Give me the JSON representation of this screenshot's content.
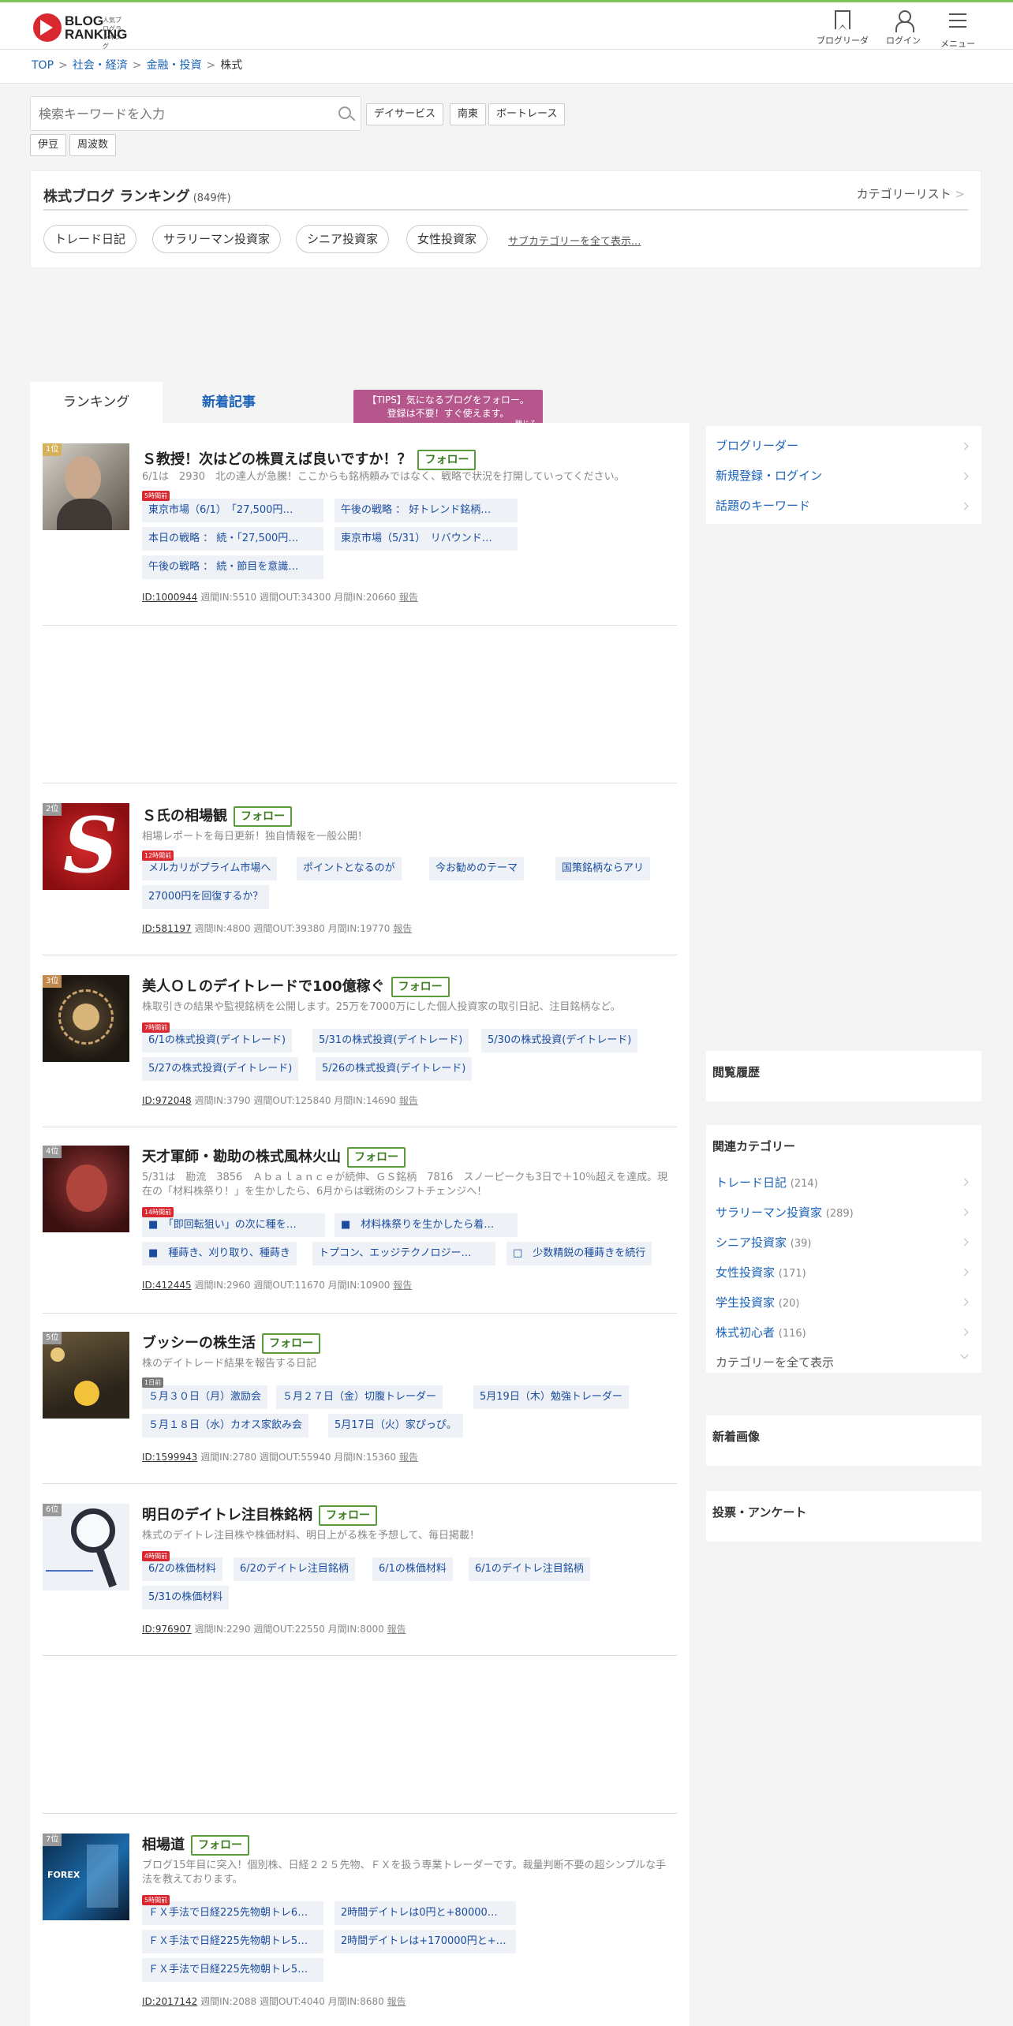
{
  "header": {
    "logo_line1": "BLOG",
    "logo_line2": "RANKING",
    "logo_sub": "人気ブログランキング",
    "nav": [
      {
        "label": "ブログリーダー",
        "icon": "bookmark-icon"
      },
      {
        "label": "ログイン",
        "icon": "user-icon"
      },
      {
        "label": "メニュー",
        "icon": "hamburger-menu-icon"
      }
    ],
    "accent_color": "#7cc35a"
  },
  "breadcrumb": {
    "items": [
      "TOP",
      "社会・経済",
      "金融・投資"
    ],
    "current": "株式",
    "separator": ">"
  },
  "search": {
    "placeholder": "検索キーワードを入力",
    "keywords": [
      "デイサービス",
      "南東",
      "ボートレース",
      "伊豆",
      "周波数"
    ]
  },
  "category": {
    "title": "株式ブログ ランキング",
    "count": "(849件)",
    "list_link": "カテゴリーリスト",
    "subcategories": [
      "トレード日記",
      "サラリーマン投資家",
      "シニア投資家",
      "女性投資家"
    ],
    "show_all_sub": "サブカテゴリーを全て表示..."
  },
  "tabs": {
    "ranking": "ランキング",
    "new_articles": "新着記事"
  },
  "tips": {
    "line1": "【TIPS】気になるブログをフォロー。",
    "line2": "登録は不要！すぐ使えます。",
    "close": "閉じる"
  },
  "follow_label": "フォロー",
  "entries": [
    {
      "rank": "1位",
      "title": "Ｓ教授！次はどの株買えば良いですか！？",
      "desc": "6/1は　2930　北の達人が急騰！ここからも銘柄頼みではなく、戦略で状況を打開していってください。",
      "badge": "5時間前",
      "articles": [
        "東京市場（6/1）　「27,500円…",
        "午後の戦略 ： 好トレンド銘柄…",
        "本日の戦略 ： 続・「27,500円…",
        "東京市場（5/31）　リバウンド…",
        "午後の戦略 ： 続・節目を意識…"
      ],
      "id": "ID:1000944",
      "stats": "週間IN:5510 週間OUT:34300 月間IN:20660",
      "report": "報告"
    },
    {
      "rank": "2位",
      "title": "Ｓ氏の相場観",
      "desc": "相場レポートを毎日更新！独自情報を一般公開！",
      "badge": "12時間前",
      "articles": [
        "メルカリがプライム市場へ",
        "ポイントとなるのが",
        "今お勧めのテーマ",
        "国策銘柄ならアリ",
        "27000円を回復するか？"
      ],
      "id": "ID:581197",
      "stats": "週間IN:4800 週間OUT:39380 月間IN:19770",
      "report": "報告"
    },
    {
      "rank": "3位",
      "title": "美人ＯＬのデイトレードで100億稼ぐ",
      "desc": "株取引きの結果や監視銘柄を公開します。25万を7000万にした個人投資家の取引日記、注目銘柄など。",
      "badge": "7時間前",
      "articles": [
        "6/1の株式投資(デイトレード)",
        "5/31の株式投資(デイトレード)",
        "5/30の株式投資(デイトレード)",
        "5/27の株式投資(デイトレード)",
        "5/26の株式投資(デイトレード)"
      ],
      "id": "ID:972048",
      "stats": "週間IN:3790 週間OUT:125840 月間IN:14690",
      "report": "報告"
    },
    {
      "rank": "4位",
      "title": "天才軍師・勘助の株式風林火山",
      "desc": "5/31は　勘流　3856　Ａｂａｌａｎｃｅが続伸、ＧＳ銘柄　7816　スノーピークも3日で＋10％超えを達成。現在の「材料株祭り！」を生かしたら、6月からは戦術のシフトチェンジへ！",
      "badge": "14時間前",
      "articles": [
        "■　「即回転狙い」の次に種を…",
        "■　材料株祭りを生かしたら着…",
        "■　種蒔き、刈り取り、種蒔き",
        "トプコン、エッジテクノロジー…",
        "□　少数精鋭の種蒔きを続行"
      ],
      "id": "ID:412445",
      "stats": "週間IN:2960 週間OUT:11670 月間IN:10900",
      "report": "報告"
    },
    {
      "rank": "5位",
      "title": "ブッシーの株生活",
      "desc": "株のデイトレード結果を報告する日記",
      "badge": "1日前",
      "articles": [
        "５月３０日（月）激励会",
        "５月２７日（金）切腹トレーダー",
        "5月19日（木）勉強トレーダー",
        "５月１８日（水）カオス家飲み会",
        "5月17日（火）家ぴっぴ。"
      ],
      "id": "ID:1599943",
      "stats": "週間IN:2780 週間OUT:55940 月間IN:15360",
      "report": "報告"
    },
    {
      "rank": "6位",
      "title": "明日のデイトレ注目株銘柄",
      "desc": "株式のデイトレ注目株や株価材料、明日上がる株を予想して、毎日掲載！",
      "badge": "4時間前",
      "articles": [
        "6/2の株価材料",
        "6/2のデイトレ注目銘柄",
        "6/1の株価材料",
        "6/1のデイトレ注目銘柄",
        "5/31の株価材料"
      ],
      "id": "ID:976907",
      "stats": "週間IN:2290 週間OUT:22550 月間IN:8000",
      "report": "報告"
    },
    {
      "rank": "7位",
      "title": "相場道",
      "desc": "ブログ15年目に突入！個別株、日経２２５先物、ＦＸを扱う専業トレーダーです。裁量判断不要の超シンプルな手法を教えております。",
      "badge": "5時間前",
      "articles": [
        "ＦＸ手法で日経225先物朝トレ6…",
        "2時間デイトレは0円と+80000…",
        "ＦＸ手法で日経225先物朝トレ5…",
        "2時間デイトレは+170000円と+…",
        "ＦＸ手法で日経225先物朝トレ5…"
      ],
      "id": "ID:2017142",
      "stats": "週間IN:2088 週間OUT:4040 月間IN:8680",
      "report": "報告"
    }
  ],
  "sidebar": {
    "links": [
      "ブログリーダー",
      "新規登録・ログイン",
      "話題のキーワード"
    ],
    "history_title": "閲覧履歴",
    "related_title": "関連カテゴリー",
    "related": [
      {
        "name": "トレード日記",
        "count": "(214)"
      },
      {
        "name": "サラリーマン投資家",
        "count": "(289)"
      },
      {
        "name": "シニア投資家",
        "count": "(39)"
      },
      {
        "name": "女性投資家",
        "count": "(171)"
      },
      {
        "name": "学生投資家",
        "count": "(20)"
      },
      {
        "name": "株式初心者",
        "count": "(116)"
      }
    ],
    "show_all_categories": "カテゴリーを全て表示",
    "new_images_title": "新着画像",
    "poll_title": "投票・アンケート"
  }
}
